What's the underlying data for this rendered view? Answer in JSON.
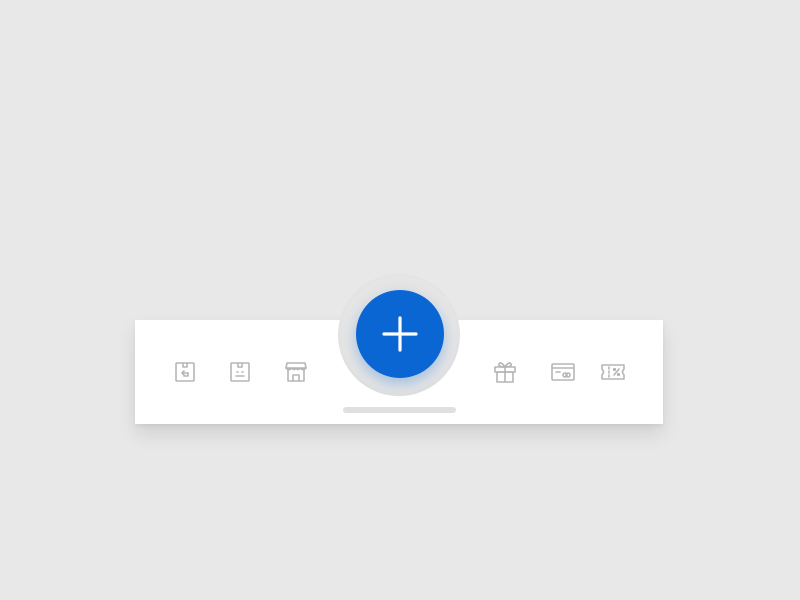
{
  "colors": {
    "background": "#e8e8e8",
    "bar": "#ffffff",
    "accent": "#0a66d2",
    "icon": "#b5b5b5",
    "notch": "#e5e5e5"
  },
  "tabbar": {
    "left_items": [
      {
        "icon": "package-return-icon"
      },
      {
        "icon": "package-box-icon"
      },
      {
        "icon": "store-icon"
      }
    ],
    "center_button": {
      "icon": "plus-icon"
    },
    "right_items": [
      {
        "icon": "gift-icon"
      },
      {
        "icon": "credit-card-icon"
      },
      {
        "icon": "discount-ticket-icon"
      }
    ]
  }
}
